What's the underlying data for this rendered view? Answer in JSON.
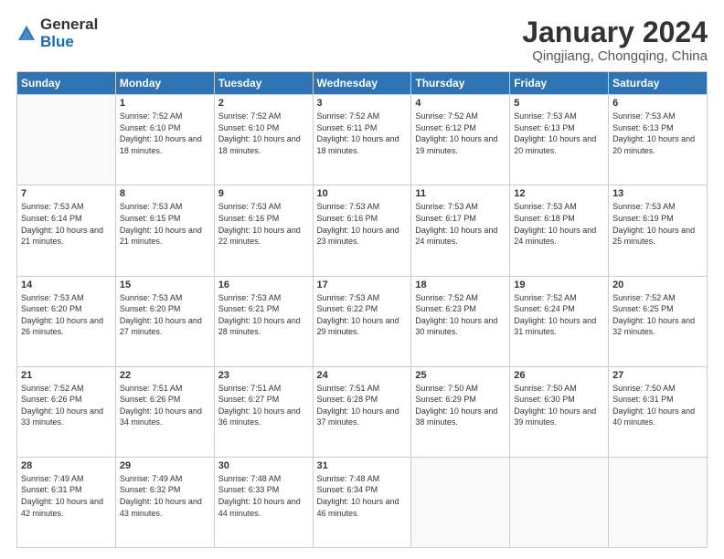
{
  "logo": {
    "general": "General",
    "blue": "Blue"
  },
  "title": "January 2024",
  "subtitle": "Qingjiang, Chongqing, China",
  "headers": [
    "Sunday",
    "Monday",
    "Tuesday",
    "Wednesday",
    "Thursday",
    "Friday",
    "Saturday"
  ],
  "weeks": [
    [
      {
        "day": "",
        "sunrise": "",
        "sunset": "",
        "daylight": ""
      },
      {
        "day": "1",
        "sunrise": "Sunrise: 7:52 AM",
        "sunset": "Sunset: 6:10 PM",
        "daylight": "Daylight: 10 hours and 18 minutes."
      },
      {
        "day": "2",
        "sunrise": "Sunrise: 7:52 AM",
        "sunset": "Sunset: 6:10 PM",
        "daylight": "Daylight: 10 hours and 18 minutes."
      },
      {
        "day": "3",
        "sunrise": "Sunrise: 7:52 AM",
        "sunset": "Sunset: 6:11 PM",
        "daylight": "Daylight: 10 hours and 18 minutes."
      },
      {
        "day": "4",
        "sunrise": "Sunrise: 7:52 AM",
        "sunset": "Sunset: 6:12 PM",
        "daylight": "Daylight: 10 hours and 19 minutes."
      },
      {
        "day": "5",
        "sunrise": "Sunrise: 7:53 AM",
        "sunset": "Sunset: 6:13 PM",
        "daylight": "Daylight: 10 hours and 20 minutes."
      },
      {
        "day": "6",
        "sunrise": "Sunrise: 7:53 AM",
        "sunset": "Sunset: 6:13 PM",
        "daylight": "Daylight: 10 hours and 20 minutes."
      }
    ],
    [
      {
        "day": "7",
        "sunrise": "Sunrise: 7:53 AM",
        "sunset": "Sunset: 6:14 PM",
        "daylight": "Daylight: 10 hours and 21 minutes."
      },
      {
        "day": "8",
        "sunrise": "Sunrise: 7:53 AM",
        "sunset": "Sunset: 6:15 PM",
        "daylight": "Daylight: 10 hours and 21 minutes."
      },
      {
        "day": "9",
        "sunrise": "Sunrise: 7:53 AM",
        "sunset": "Sunset: 6:16 PM",
        "daylight": "Daylight: 10 hours and 22 minutes."
      },
      {
        "day": "10",
        "sunrise": "Sunrise: 7:53 AM",
        "sunset": "Sunset: 6:16 PM",
        "daylight": "Daylight: 10 hours and 23 minutes."
      },
      {
        "day": "11",
        "sunrise": "Sunrise: 7:53 AM",
        "sunset": "Sunset: 6:17 PM",
        "daylight": "Daylight: 10 hours and 24 minutes."
      },
      {
        "day": "12",
        "sunrise": "Sunrise: 7:53 AM",
        "sunset": "Sunset: 6:18 PM",
        "daylight": "Daylight: 10 hours and 24 minutes."
      },
      {
        "day": "13",
        "sunrise": "Sunrise: 7:53 AM",
        "sunset": "Sunset: 6:19 PM",
        "daylight": "Daylight: 10 hours and 25 minutes."
      }
    ],
    [
      {
        "day": "14",
        "sunrise": "Sunrise: 7:53 AM",
        "sunset": "Sunset: 6:20 PM",
        "daylight": "Daylight: 10 hours and 26 minutes."
      },
      {
        "day": "15",
        "sunrise": "Sunrise: 7:53 AM",
        "sunset": "Sunset: 6:20 PM",
        "daylight": "Daylight: 10 hours and 27 minutes."
      },
      {
        "day": "16",
        "sunrise": "Sunrise: 7:53 AM",
        "sunset": "Sunset: 6:21 PM",
        "daylight": "Daylight: 10 hours and 28 minutes."
      },
      {
        "day": "17",
        "sunrise": "Sunrise: 7:53 AM",
        "sunset": "Sunset: 6:22 PM",
        "daylight": "Daylight: 10 hours and 29 minutes."
      },
      {
        "day": "18",
        "sunrise": "Sunrise: 7:52 AM",
        "sunset": "Sunset: 6:23 PM",
        "daylight": "Daylight: 10 hours and 30 minutes."
      },
      {
        "day": "19",
        "sunrise": "Sunrise: 7:52 AM",
        "sunset": "Sunset: 6:24 PM",
        "daylight": "Daylight: 10 hours and 31 minutes."
      },
      {
        "day": "20",
        "sunrise": "Sunrise: 7:52 AM",
        "sunset": "Sunset: 6:25 PM",
        "daylight": "Daylight: 10 hours and 32 minutes."
      }
    ],
    [
      {
        "day": "21",
        "sunrise": "Sunrise: 7:52 AM",
        "sunset": "Sunset: 6:26 PM",
        "daylight": "Daylight: 10 hours and 33 minutes."
      },
      {
        "day": "22",
        "sunrise": "Sunrise: 7:51 AM",
        "sunset": "Sunset: 6:26 PM",
        "daylight": "Daylight: 10 hours and 34 minutes."
      },
      {
        "day": "23",
        "sunrise": "Sunrise: 7:51 AM",
        "sunset": "Sunset: 6:27 PM",
        "daylight": "Daylight: 10 hours and 36 minutes."
      },
      {
        "day": "24",
        "sunrise": "Sunrise: 7:51 AM",
        "sunset": "Sunset: 6:28 PM",
        "daylight": "Daylight: 10 hours and 37 minutes."
      },
      {
        "day": "25",
        "sunrise": "Sunrise: 7:50 AM",
        "sunset": "Sunset: 6:29 PM",
        "daylight": "Daylight: 10 hours and 38 minutes."
      },
      {
        "day": "26",
        "sunrise": "Sunrise: 7:50 AM",
        "sunset": "Sunset: 6:30 PM",
        "daylight": "Daylight: 10 hours and 39 minutes."
      },
      {
        "day": "27",
        "sunrise": "Sunrise: 7:50 AM",
        "sunset": "Sunset: 6:31 PM",
        "daylight": "Daylight: 10 hours and 40 minutes."
      }
    ],
    [
      {
        "day": "28",
        "sunrise": "Sunrise: 7:49 AM",
        "sunset": "Sunset: 6:31 PM",
        "daylight": "Daylight: 10 hours and 42 minutes."
      },
      {
        "day": "29",
        "sunrise": "Sunrise: 7:49 AM",
        "sunset": "Sunset: 6:32 PM",
        "daylight": "Daylight: 10 hours and 43 minutes."
      },
      {
        "day": "30",
        "sunrise": "Sunrise: 7:48 AM",
        "sunset": "Sunset: 6:33 PM",
        "daylight": "Daylight: 10 hours and 44 minutes."
      },
      {
        "day": "31",
        "sunrise": "Sunrise: 7:48 AM",
        "sunset": "Sunset: 6:34 PM",
        "daylight": "Daylight: 10 hours and 46 minutes."
      },
      {
        "day": "",
        "sunrise": "",
        "sunset": "",
        "daylight": ""
      },
      {
        "day": "",
        "sunrise": "",
        "sunset": "",
        "daylight": ""
      },
      {
        "day": "",
        "sunrise": "",
        "sunset": "",
        "daylight": ""
      }
    ]
  ]
}
